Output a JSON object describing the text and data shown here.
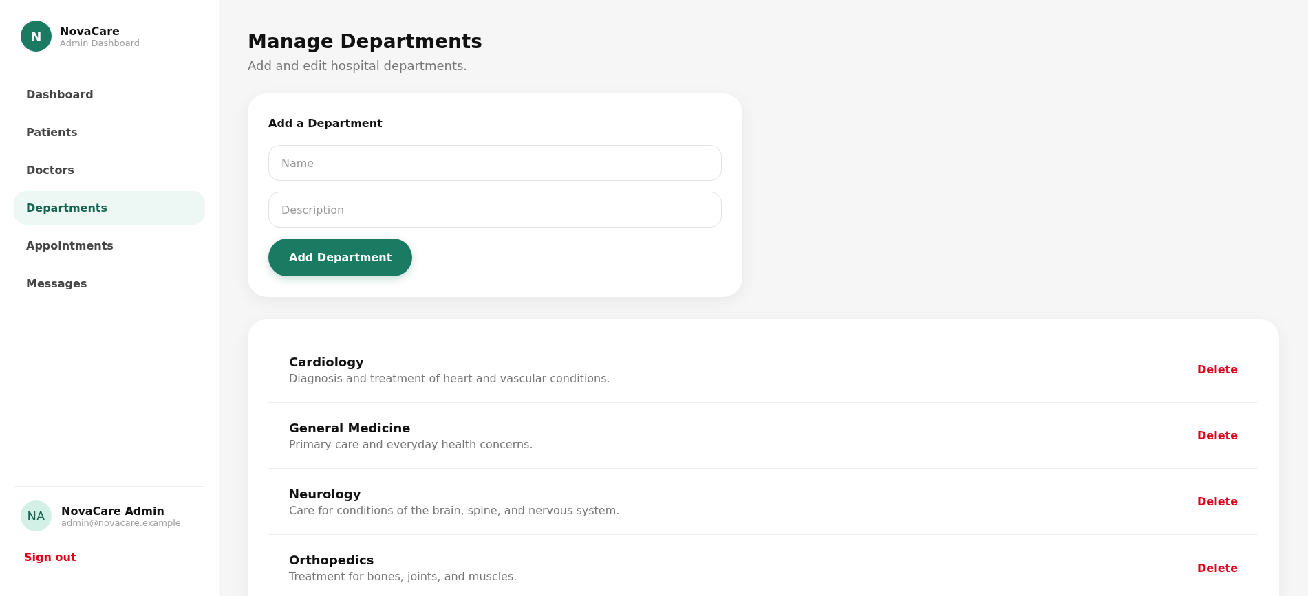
{
  "brand": {
    "logo_letter": "N",
    "name": "NovaCare",
    "subtitle": "Admin Dashboard"
  },
  "nav": [
    {
      "label": "Dashboard",
      "selected": false
    },
    {
      "label": "Patients",
      "selected": false
    },
    {
      "label": "Doctors",
      "selected": false
    },
    {
      "label": "Departments",
      "selected": true
    },
    {
      "label": "Appointments",
      "selected": false
    },
    {
      "label": "Messages",
      "selected": false
    }
  ],
  "user": {
    "initials": "NA",
    "name": "NovaCare Admin",
    "email": "admin@novacare.example"
  },
  "sign_out": "Sign out",
  "page": {
    "title": "Manage Departments",
    "subtitle": "Add and edit hospital departments."
  },
  "form": {
    "title": "Add a Department",
    "fields": [
      {
        "placeholder": "Name"
      },
      {
        "placeholder": "Description"
      }
    ],
    "submit": "Add Department"
  },
  "departments": [
    {
      "name": "Cardiology",
      "description": "Diagnosis and treatment of heart and vascular conditions.",
      "action": "Delete"
    },
    {
      "name": "General Medicine",
      "description": "Primary care and everyday health concerns.",
      "action": "Delete"
    },
    {
      "name": "Neurology",
      "description": "Care for conditions of the brain, spine, and nervous system.",
      "action": "Delete"
    },
    {
      "name": "Orthopedics",
      "description": "Treatment for bones, joints, and muscles.",
      "action": "Delete"
    }
  ]
}
